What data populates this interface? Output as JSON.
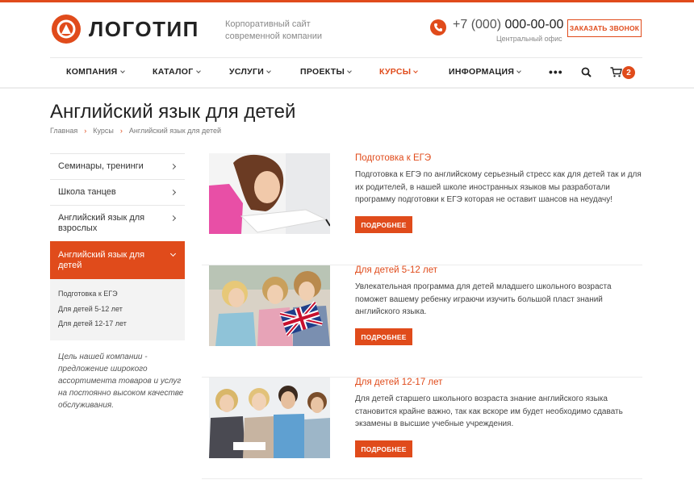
{
  "header": {
    "logo_text": "ЛОГОТИП",
    "slogan": "Корпоративный сайт современной компании",
    "phone_code": "+7 (000)",
    "phone_number": "000-00-00",
    "phone_sub": "Центральный офис",
    "callback_label": "ЗАКАЗАТЬ ЗВОНОК"
  },
  "nav": {
    "items": [
      {
        "label": "КОМПАНИЯ"
      },
      {
        "label": "КАТАЛОГ"
      },
      {
        "label": "УСЛУГИ"
      },
      {
        "label": "ПРОЕКТЫ"
      },
      {
        "label": "КУРСЫ"
      },
      {
        "label": "ИНФОРМАЦИЯ"
      }
    ],
    "more": "•••",
    "cart_count": "2"
  },
  "page": {
    "title": "Английский язык для детей",
    "breadcrumb": [
      "Главная",
      "Курсы",
      "Английский язык для детей"
    ]
  },
  "sidebar": {
    "items": [
      {
        "label": "Семинары, тренинги"
      },
      {
        "label": "Школа танцев"
      },
      {
        "label": "Английский язык для взрослых"
      },
      {
        "label": "Английский язык для детей"
      }
    ],
    "subitems": [
      "Подготовка к ЕГЭ",
      "Для детей 5-12 лет",
      "Для детей 12-17 лет"
    ],
    "note": "Цель нашей компании - предложение широкого ассортимента товаров и услуг на постоянно высоком качестве обслуживания."
  },
  "courses": [
    {
      "title": "Подготовка к ЕГЭ",
      "text": "Подготовка к ЕГЭ по английскому серьезный стресс как для детей так и для их родителей, в нашей школе иностранных языков мы разработали программу подготовки к ЕГЭ которая не оставит шансов на неудачу!",
      "button": "ПОДРОБНЕЕ"
    },
    {
      "title": "Для детей 5-12 лет",
      "text": "Увлекательная программа для детей младшего школьного возраста поможет вашему ребенку играючи изучить большой пласт знаний английского языка.",
      "button": "ПОДРОБНЕЕ"
    },
    {
      "title": "Для детей 12-17 лет",
      "text": "Для детей старшего школьного возраста знание английского языка становится крайне важно, так как вскоре им будет необходимо сдавать экзамены в высшие учебные учреждения.",
      "button": "ПОДРОБНЕЕ"
    }
  ],
  "colors": {
    "accent": "#e04b1b"
  }
}
